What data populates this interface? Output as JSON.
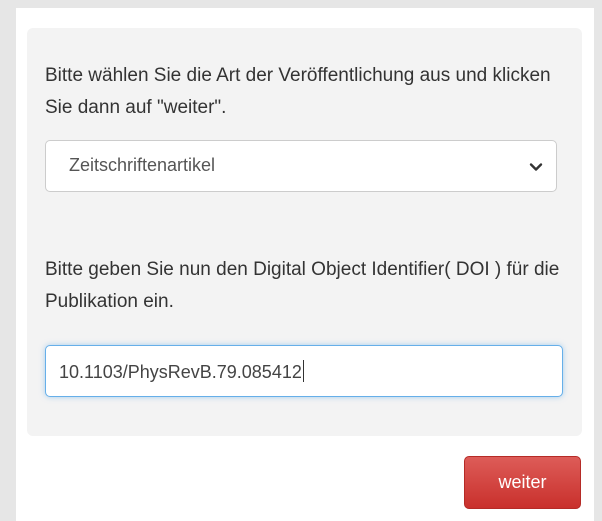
{
  "form": {
    "type_instruction": "Bitte wählen Sie die Art der Veröffentlichung aus und klicken Sie dann auf \"weiter\".",
    "type_select": {
      "selected": "Zeitschriftenartikel",
      "icon": "chevron-down-icon"
    },
    "doi_instruction": "Bitte geben Sie nun den Digital Object Identifier( DOI ) für die Publikation ein.",
    "doi_input": {
      "value": "10.1103/PhysRevB.79.085412"
    },
    "submit_label": "weiter"
  },
  "colors": {
    "page_background": "#e6e6e6",
    "panel_background": "#f3f3f3",
    "focus_border": "#66afe9",
    "button_danger": "#d9534f",
    "text": "#333333"
  }
}
